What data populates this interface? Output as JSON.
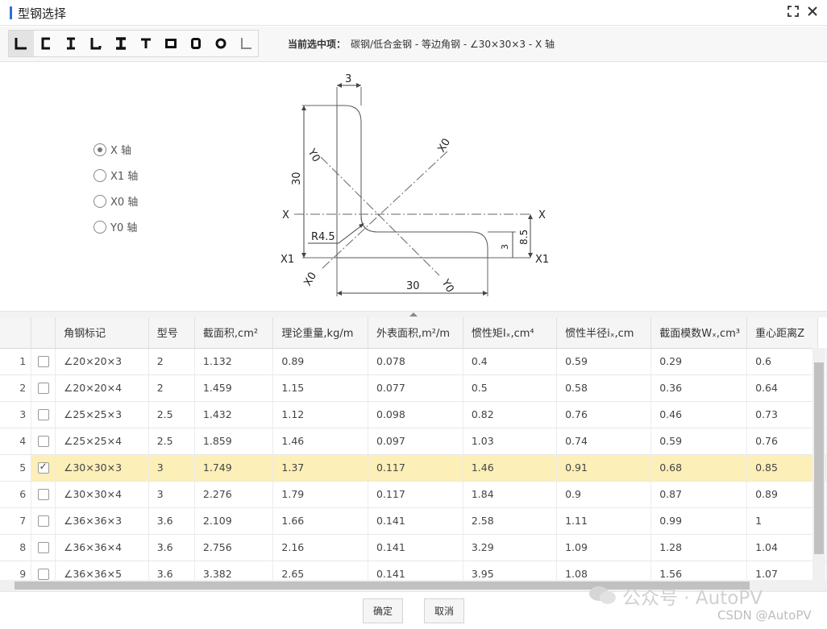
{
  "window": {
    "title": "型钢选择"
  },
  "toolbar": {
    "shapes": [
      {
        "name": "angle-equal"
      },
      {
        "name": "channel"
      },
      {
        "name": "i-beam"
      },
      {
        "name": "angle-unequal"
      },
      {
        "name": "h-beam"
      },
      {
        "name": "t-beam"
      },
      {
        "name": "rect-tube"
      },
      {
        "name": "square-tube"
      },
      {
        "name": "round-tube"
      },
      {
        "name": "cold-formed-angle"
      }
    ],
    "current_label": "当前选中项：",
    "current_value": "碳钢/低合金钢 - 等边角钢 - ∠30×30×3 - X 轴"
  },
  "axis_options": [
    {
      "label": "X 轴",
      "checked": true
    },
    {
      "label": "X1 轴",
      "checked": false
    },
    {
      "label": "X0 轴",
      "checked": false
    },
    {
      "label": "Y0 轴",
      "checked": false
    }
  ],
  "drawing": {
    "thickness_top": "3",
    "height": "30",
    "width": "30",
    "radius": "R4.5",
    "thickness_right": "3",
    "centroid": "8.5",
    "x_left": "X",
    "x_right": "X",
    "x1_left": "X1",
    "x1_right": "X1",
    "y0_top": "Y0",
    "y0_bottom": "Y0",
    "x0_top": "X0",
    "x0_bottom": "X0"
  },
  "table": {
    "columns": [
      "角钢标记",
      "型号",
      "截面积,cm²",
      "理论重量,kg/m",
      "外表面积,m²/m",
      "惯性矩Iₓ,cm⁴",
      "惯性半径iₓ,cm",
      "截面模数Wₓ,cm³",
      "重心距离Z"
    ],
    "rows": [
      {
        "idx": "1",
        "checked": false,
        "cells": [
          "∠20×20×3",
          "2",
          "1.132",
          "0.89",
          "0.078",
          "0.4",
          "0.59",
          "0.29",
          "0.6"
        ]
      },
      {
        "idx": "2",
        "checked": false,
        "cells": [
          "∠20×20×4",
          "2",
          "1.459",
          "1.15",
          "0.077",
          "0.5",
          "0.58",
          "0.36",
          "0.64"
        ]
      },
      {
        "idx": "3",
        "checked": false,
        "cells": [
          "∠25×25×3",
          "2.5",
          "1.432",
          "1.12",
          "0.098",
          "0.82",
          "0.76",
          "0.46",
          "0.73"
        ]
      },
      {
        "idx": "4",
        "checked": false,
        "cells": [
          "∠25×25×4",
          "2.5",
          "1.859",
          "1.46",
          "0.097",
          "1.03",
          "0.74",
          "0.59",
          "0.76"
        ]
      },
      {
        "idx": "5",
        "checked": true,
        "cells": [
          "∠30×30×3",
          "3",
          "1.749",
          "1.37",
          "0.117",
          "1.46",
          "0.91",
          "0.68",
          "0.85"
        ]
      },
      {
        "idx": "6",
        "checked": false,
        "cells": [
          "∠30×30×4",
          "3",
          "2.276",
          "1.79",
          "0.117",
          "1.84",
          "0.9",
          "0.87",
          "0.89"
        ]
      },
      {
        "idx": "7",
        "checked": false,
        "cells": [
          "∠36×36×3",
          "3.6",
          "2.109",
          "1.66",
          "0.141",
          "2.58",
          "1.11",
          "0.99",
          "1"
        ]
      },
      {
        "idx": "8",
        "checked": false,
        "cells": [
          "∠36×36×4",
          "3.6",
          "2.756",
          "2.16",
          "0.141",
          "3.29",
          "1.09",
          "1.28",
          "1.04"
        ]
      },
      {
        "idx": "9",
        "checked": false,
        "cells": [
          "∠36×36×5",
          "3.6",
          "3.382",
          "2.65",
          "0.141",
          "3.95",
          "1.08",
          "1.56",
          "1.07"
        ]
      }
    ]
  },
  "footer": {
    "ok": "确定",
    "cancel": "取消"
  },
  "watermark": {
    "text": "公众号 · AutoPV",
    "csdn": "CSDN @AutoPV"
  },
  "colors": {
    "accent": "#2e6fd8",
    "selected_row": "#fcefb8"
  }
}
